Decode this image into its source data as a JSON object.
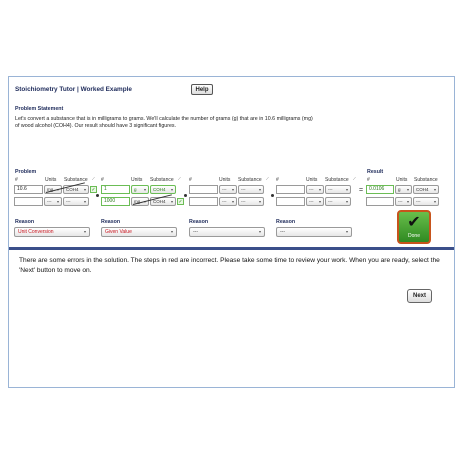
{
  "header": {
    "title": "Stoichiometry Tutor  |  Worked Example",
    "help_label": "Help"
  },
  "problem_statement": {
    "label": "Problem Statement",
    "text": "Let's convert a substance that is in milligrams to grams.  We'll calculate the number of grams (g) that are in 10.6 milligrams (mg) of wood alcohol (COH4). Our result should have 3 significant figures."
  },
  "problem": {
    "label": "Problem",
    "col_number": "#",
    "col_units": "Units",
    "col_substance": "Substance",
    "term1": {
      "num_top": "10.6",
      "units_top": "mg",
      "subst_top": "COH4",
      "num_bottom": "",
      "units_bottom": "---",
      "subst_bottom": "---"
    },
    "term2": {
      "num_top": "1",
      "units_top": "g",
      "subst_top": "COH4",
      "num_bottom": "1000",
      "units_bottom": "mg",
      "subst_bottom": "COH4"
    },
    "term3": {
      "units_top": "---",
      "subst_top": "---",
      "units_bottom": "---",
      "subst_bottom": "---"
    },
    "term4": {
      "units_top": "---",
      "subst_top": "---",
      "units_bottom": "---",
      "subst_bottom": "---"
    },
    "equals": "="
  },
  "result": {
    "label": "Result",
    "number": "0.0106",
    "units": "g",
    "substance": "COH4",
    "units_bottom": "---",
    "subst_bottom": "---"
  },
  "reasons": {
    "label": "Reason",
    "items": [
      {
        "value": "Unit Conversion",
        "state": "error"
      },
      {
        "value": "Given Value",
        "state": "error"
      },
      {
        "value": "---",
        "state": "neutral"
      },
      {
        "value": "---",
        "state": "neutral"
      }
    ]
  },
  "done": {
    "label": "Done",
    "icon": "checkmark-icon"
  },
  "message": "There are some errors in the solution.  The steps in red are incorrect.  Please take some time to review your work.  When you are ready, select the 'Next' button to move on.",
  "next_label": "Next",
  "colors": {
    "error": "#c8141e",
    "correct": "#2a7a1a",
    "divider": "#3b4f8a",
    "done": "#2f8a22",
    "done_border": "#c7541c"
  }
}
